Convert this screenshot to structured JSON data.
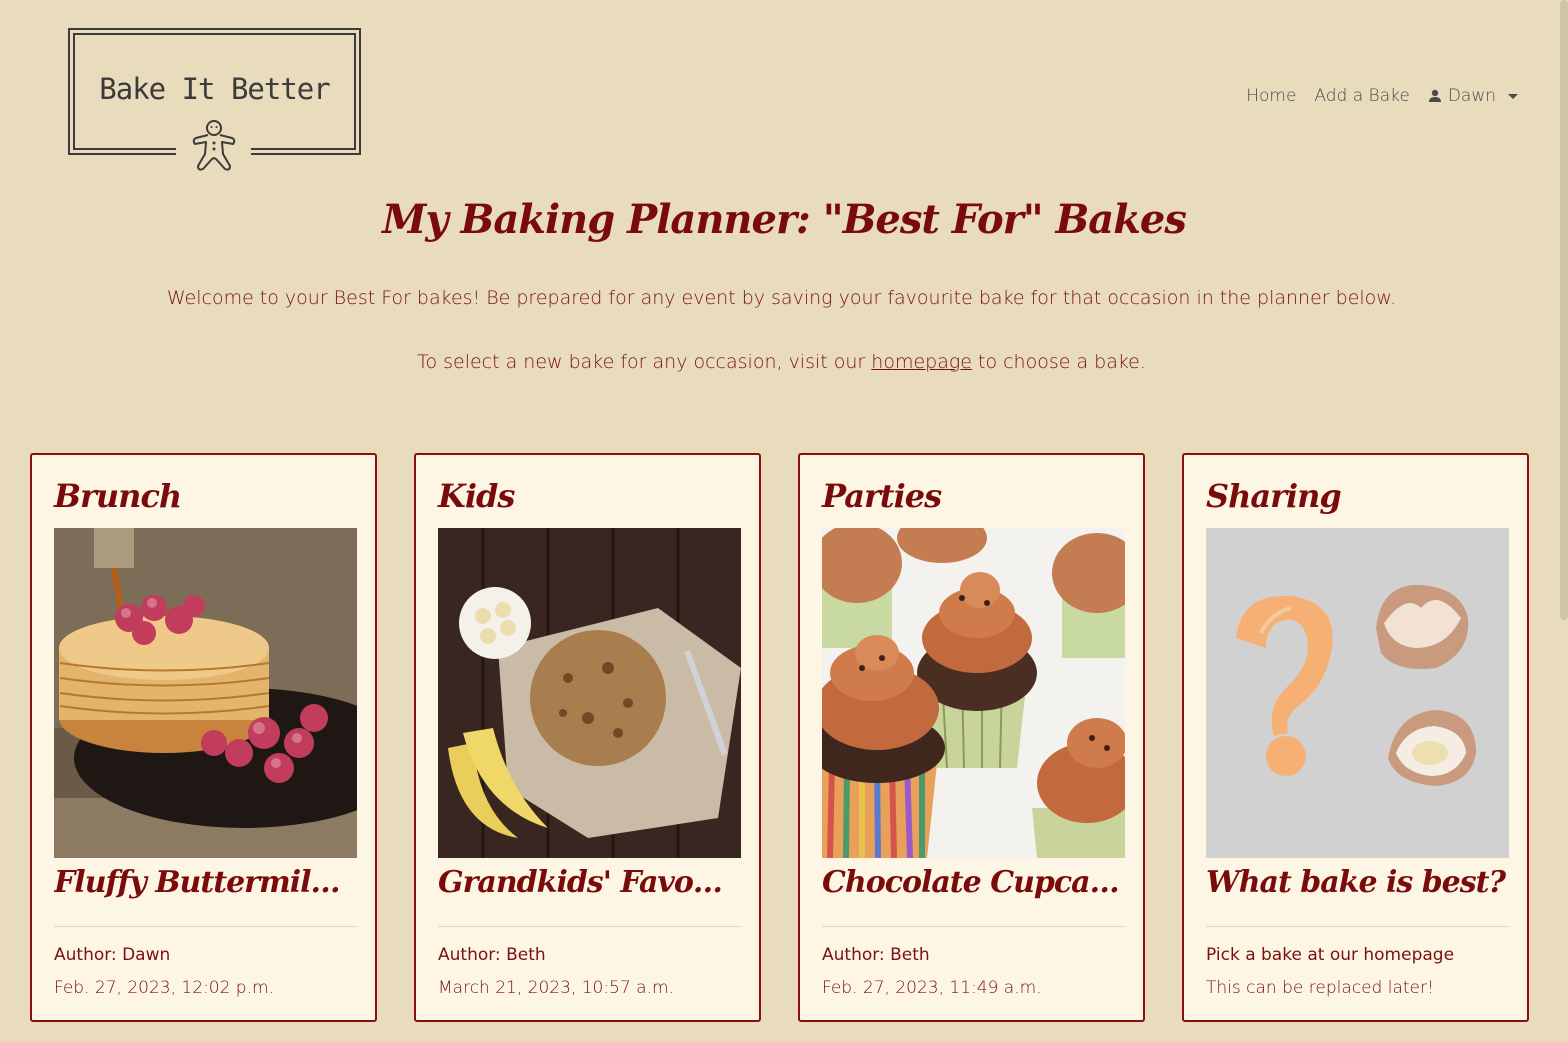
{
  "brand": {
    "logo_text": "Bake It Better"
  },
  "nav": {
    "home": "Home",
    "add_bake": "Add a Bake",
    "user": "Dawn"
  },
  "page": {
    "title": "My Baking Planner: \"Best For\" Bakes",
    "intro": "Welcome to your Best For bakes! Be prepared for any event by saving your favourite bake for that occasion in the planner below.",
    "intro2_before": "To select a new bake for any occasion, visit our ",
    "intro2_link": "homepage",
    "intro2_after": " to choose a bake."
  },
  "cards": [
    {
      "category": "Brunch",
      "title": "Fluffy Buttermilk P...",
      "author": "Author: Dawn",
      "date": "Feb. 27, 2023, 12:02 p.m.",
      "image": "pancakes-with-raspberries"
    },
    {
      "category": "Kids",
      "title": "Grandkids' Favourit...",
      "author": "Author: Beth",
      "date": "March 21, 2023, 10:57 a.m.",
      "image": "cookie-with-bananas"
    },
    {
      "category": "Parties",
      "title": "Chocolate Cupcakes",
      "author": "Author: Beth",
      "date": "Feb. 27, 2023, 11:49 a.m.",
      "image": "chocolate-cupcakes"
    },
    {
      "category": "Sharing",
      "title": "What bake is best?",
      "author": "Pick a bake at our homepage",
      "date": "This can be replaced later!",
      "image": "question-mark-eggs"
    }
  ],
  "colors": {
    "background": "#e9dcbd",
    "card_bg": "#fdf6e4",
    "accent": "#7a0b0b"
  }
}
